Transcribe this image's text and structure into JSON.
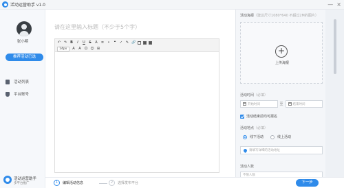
{
  "app": {
    "title": "活动运营助手 v1.0"
  },
  "window_controls": {
    "minimize": "—",
    "close": "×"
  },
  "sidebar": {
    "user_name": "张小明",
    "cta_label": "推荐活动已选",
    "items": [
      {
        "label": "活动列表",
        "icon": "list-icon"
      },
      {
        "label": "平台账号",
        "icon": "user-icon"
      }
    ],
    "help": {
      "title": "活动运营助手",
      "subtitle": "多平台推广"
    }
  },
  "editor": {
    "title_placeholder": "请在这里输入标题（不少于5个字）",
    "toolbar": {
      "row1": [
        "↶",
        "↷",
        "B",
        "I",
        "U",
        "S",
        "A",
        "≡",
        "•",
        "❝",
        "✓",
        "✎",
        "🔗"
      ],
      "font_size": "14px",
      "row2_symbols": [
        "A",
        "A",
        "Ω",
        "☺",
        "⊞"
      ]
    }
  },
  "panel": {
    "cover_label": "活动海报",
    "cover_hint": "（建议尺寸1080*640 不超过2M的图片）",
    "upload_label": "上传海报",
    "time_label": "活动时间",
    "time_required": "（必填）",
    "start_placeholder": "开始时间",
    "end_placeholder": "结束时间",
    "date_separator": "至",
    "checkbox_label": "活动结束前均可报名",
    "location_label": "活动地点",
    "location_required": "（必填）",
    "radio_offline": "线下活动",
    "radio_online": "线上活动",
    "address_placeholder": "请填写详细的活动地址",
    "count_label": "活动人数",
    "count_placeholder": "不限人数"
  },
  "footer": {
    "steps": [
      {
        "num": "1",
        "label": "编辑活动信息",
        "active": true
      },
      {
        "num": "2",
        "label": "选择发布平台",
        "active": false
      }
    ],
    "next_label": "下一步"
  },
  "colors": {
    "accent": "#2f8bea",
    "panel_bg": "#f4f6f9",
    "sidebar_bg": "#f6f8fb"
  }
}
